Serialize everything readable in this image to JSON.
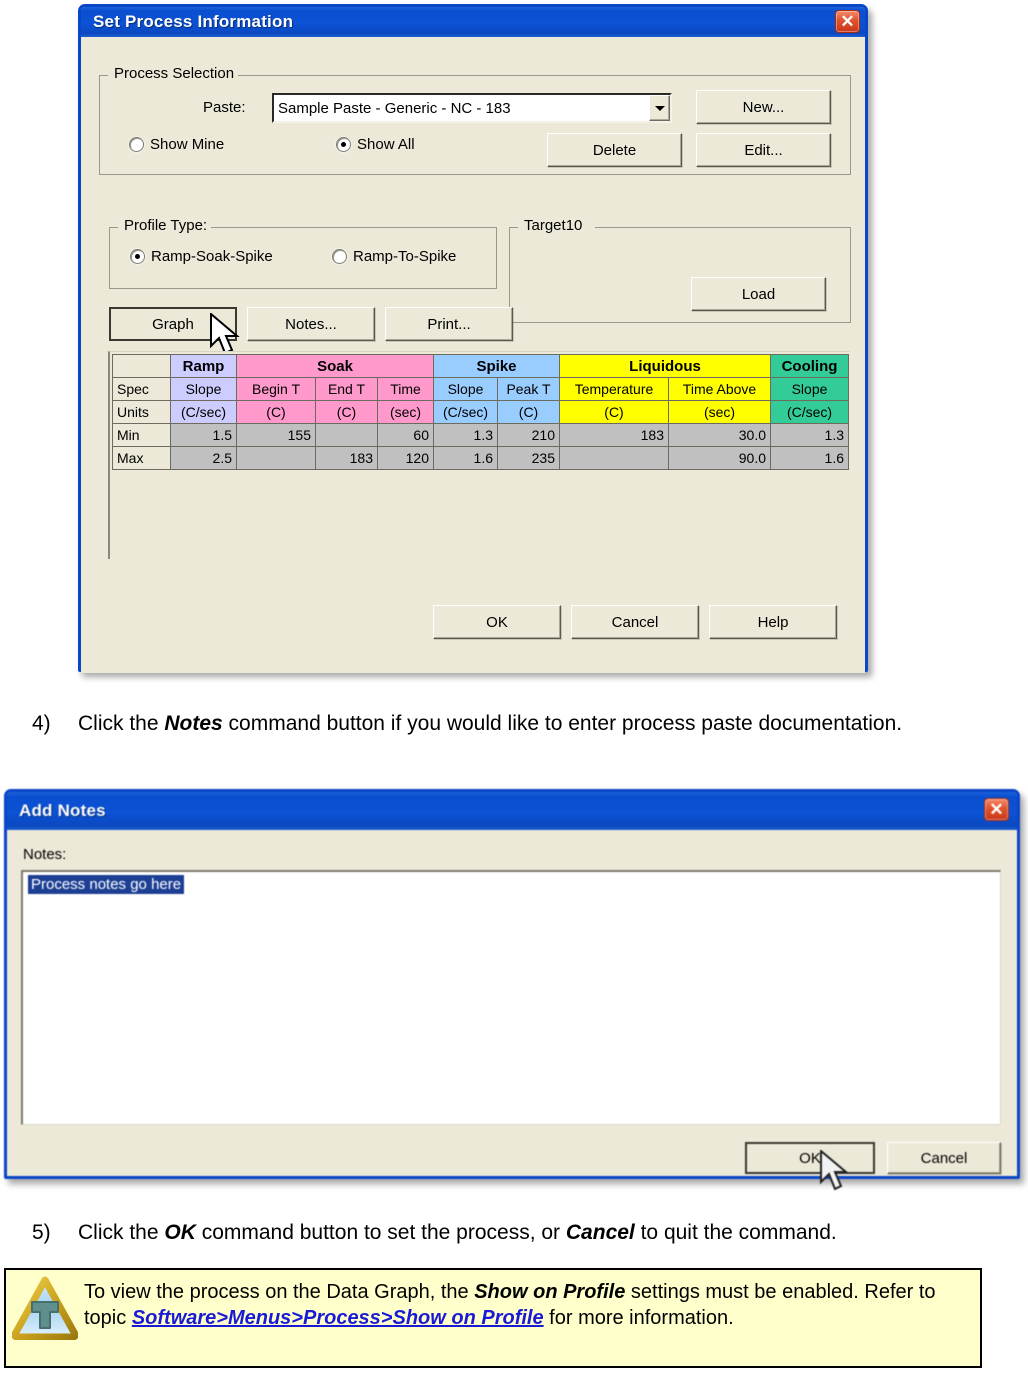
{
  "dialog1": {
    "title": "Set Process Information",
    "close_label": "✕",
    "process_selection": {
      "legend": "Process Selection",
      "paste_label": "Paste:",
      "paste_value": "Sample Paste - Generic - NC - 183",
      "show_mine_label": "Show Mine",
      "show_all_label": "Show All",
      "new_button": "New...",
      "delete_button": "Delete",
      "edit_button": "Edit..."
    },
    "profile_type": {
      "legend": "Profile Type:",
      "option1": "Ramp-Soak-Spike",
      "option2": "Ramp-To-Spike"
    },
    "target": {
      "legend": "Target10",
      "load_button": "Load"
    },
    "action_buttons": {
      "graph": "Graph",
      "notes": "Notes...",
      "print": "Print..."
    },
    "footer_buttons": {
      "ok": "OK",
      "cancel": "Cancel",
      "help": "Help"
    },
    "spec_table": {
      "group_headers": [
        "",
        "Ramp",
        "Soak",
        "Spike",
        "Liquidous",
        "Cooling"
      ],
      "row_labels": [
        "Spec",
        "Units",
        "Min",
        "Max"
      ],
      "spec_row": [
        "Spec",
        "Slope",
        "Begin T",
        "End T",
        "Time",
        "Slope",
        "Peak T",
        "Temperature",
        "Time Above",
        "Slope"
      ],
      "units_row": [
        "Units",
        "(C/sec)",
        "(C)",
        "(C)",
        "(sec)",
        "(C/sec)",
        "(C)",
        "(C)",
        "(sec)",
        "(C/sec)"
      ],
      "min_row": [
        "Min",
        "1.5",
        "155",
        "",
        "60",
        "1.3",
        "210",
        "183",
        "30.0",
        "1.3"
      ],
      "max_row": [
        "Max",
        "2.5",
        "",
        "183",
        "120",
        "1.6",
        "235",
        "",
        "90.0",
        "1.6"
      ],
      "colors": {
        "ramp": "#ccccff",
        "soak": "#ff99cc",
        "spike": "#99ccff",
        "liquidous": "#ffff00",
        "cooling": "#33cc99",
        "value_bg": "#c0c0c0"
      }
    }
  },
  "step4": {
    "number": "4)",
    "before": "Click the ",
    "bold": "Notes",
    "after": " command button if you would like to enter process paste documentation."
  },
  "dialog2": {
    "title": "Add Notes",
    "close_label": "✕",
    "notes_label": "Notes:",
    "notes_value": "Process notes go here",
    "ok_button": "OK",
    "cancel_button": "Cancel"
  },
  "step5": {
    "number": "5)",
    "p1": "Click the ",
    "b1": "OK",
    "p2": " command button to set the process, or ",
    "b2": "Cancel",
    "p3": " to quit the command."
  },
  "tip": {
    "icon": "tip-triangle-icon",
    "p1": "To view the process on the Data Graph, the ",
    "b1": "Show on Profile",
    "p2": " settings must be enabled. Refer to topic ",
    "link": "Software>Menus>Process>Show on Profile",
    "p3": " for more information."
  }
}
